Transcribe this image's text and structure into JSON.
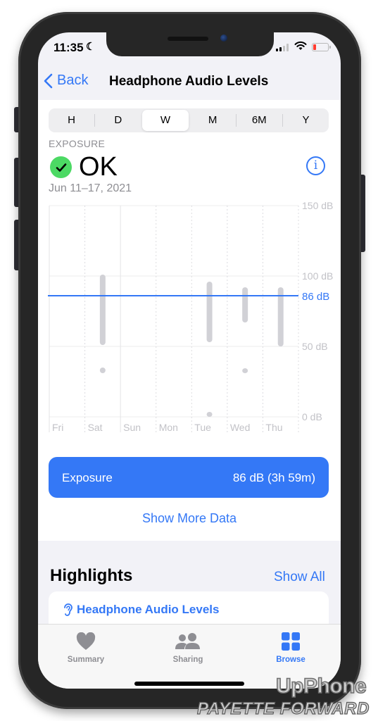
{
  "status_bar": {
    "time": "11:35",
    "focus_icon": "moon-icon",
    "signal_bars_on": 2,
    "signal_bars_total": 4,
    "battery_level": "low"
  },
  "nav": {
    "back_label": "Back",
    "title": "Headphone Audio Levels"
  },
  "segments": {
    "items": [
      "H",
      "D",
      "W",
      "M",
      "6M",
      "Y"
    ],
    "selected": "W"
  },
  "summary": {
    "label": "EXPOSURE",
    "status": "OK",
    "status_icon": "checkmark-circle-icon",
    "date_range": "Jun 11–17, 2021"
  },
  "colors": {
    "accent": "#3478f6",
    "ok_green": "#4cd964",
    "bar_gray": "#d1d1d6"
  },
  "chart_data": {
    "type": "range-bar",
    "title": "",
    "categories": [
      "Fri",
      "Sat",
      "Sun",
      "Mon",
      "Tue",
      "Wed",
      "Thu"
    ],
    "y_ticks": [
      "150 dB",
      "100 dB",
      "50 dB",
      "0 dB"
    ],
    "ylim": [
      0,
      150
    ],
    "y_unit": "dB",
    "ranges": [
      {
        "day": "Sat",
        "min": 51,
        "max": 101
      },
      {
        "day": "Tue",
        "min": 53,
        "max": 96
      },
      {
        "day": "Wed",
        "min": 67,
        "max": 92
      },
      {
        "day": "Thu",
        "min": 50,
        "max": 92
      }
    ],
    "points": [
      {
        "day": "Sat",
        "min": 31,
        "max": 35
      },
      {
        "day": "Tue",
        "min": 0,
        "max": 2
      },
      {
        "day": "Wed",
        "min": 31,
        "max": 32
      }
    ],
    "reference_line": {
      "value": 86,
      "label": "86 dB"
    }
  },
  "exposure_button": {
    "label": "Exposure",
    "value": "86 dB (3h 59m)"
  },
  "show_more_label": "Show More Data",
  "highlights": {
    "title": "Highlights",
    "show_all": "Show All",
    "card_title": "Headphone Audio Levels",
    "card_icon": "ear-icon"
  },
  "tabbar": {
    "items": [
      {
        "label": "Summary",
        "icon": "heart-icon",
        "active": false
      },
      {
        "label": "Sharing",
        "icon": "people-icon",
        "active": false
      },
      {
        "label": "Browse",
        "icon": "grid-icon",
        "active": true
      }
    ]
  },
  "watermark": {
    "line1": "UpPhone",
    "line2": "PAYETTE FORWARD"
  }
}
